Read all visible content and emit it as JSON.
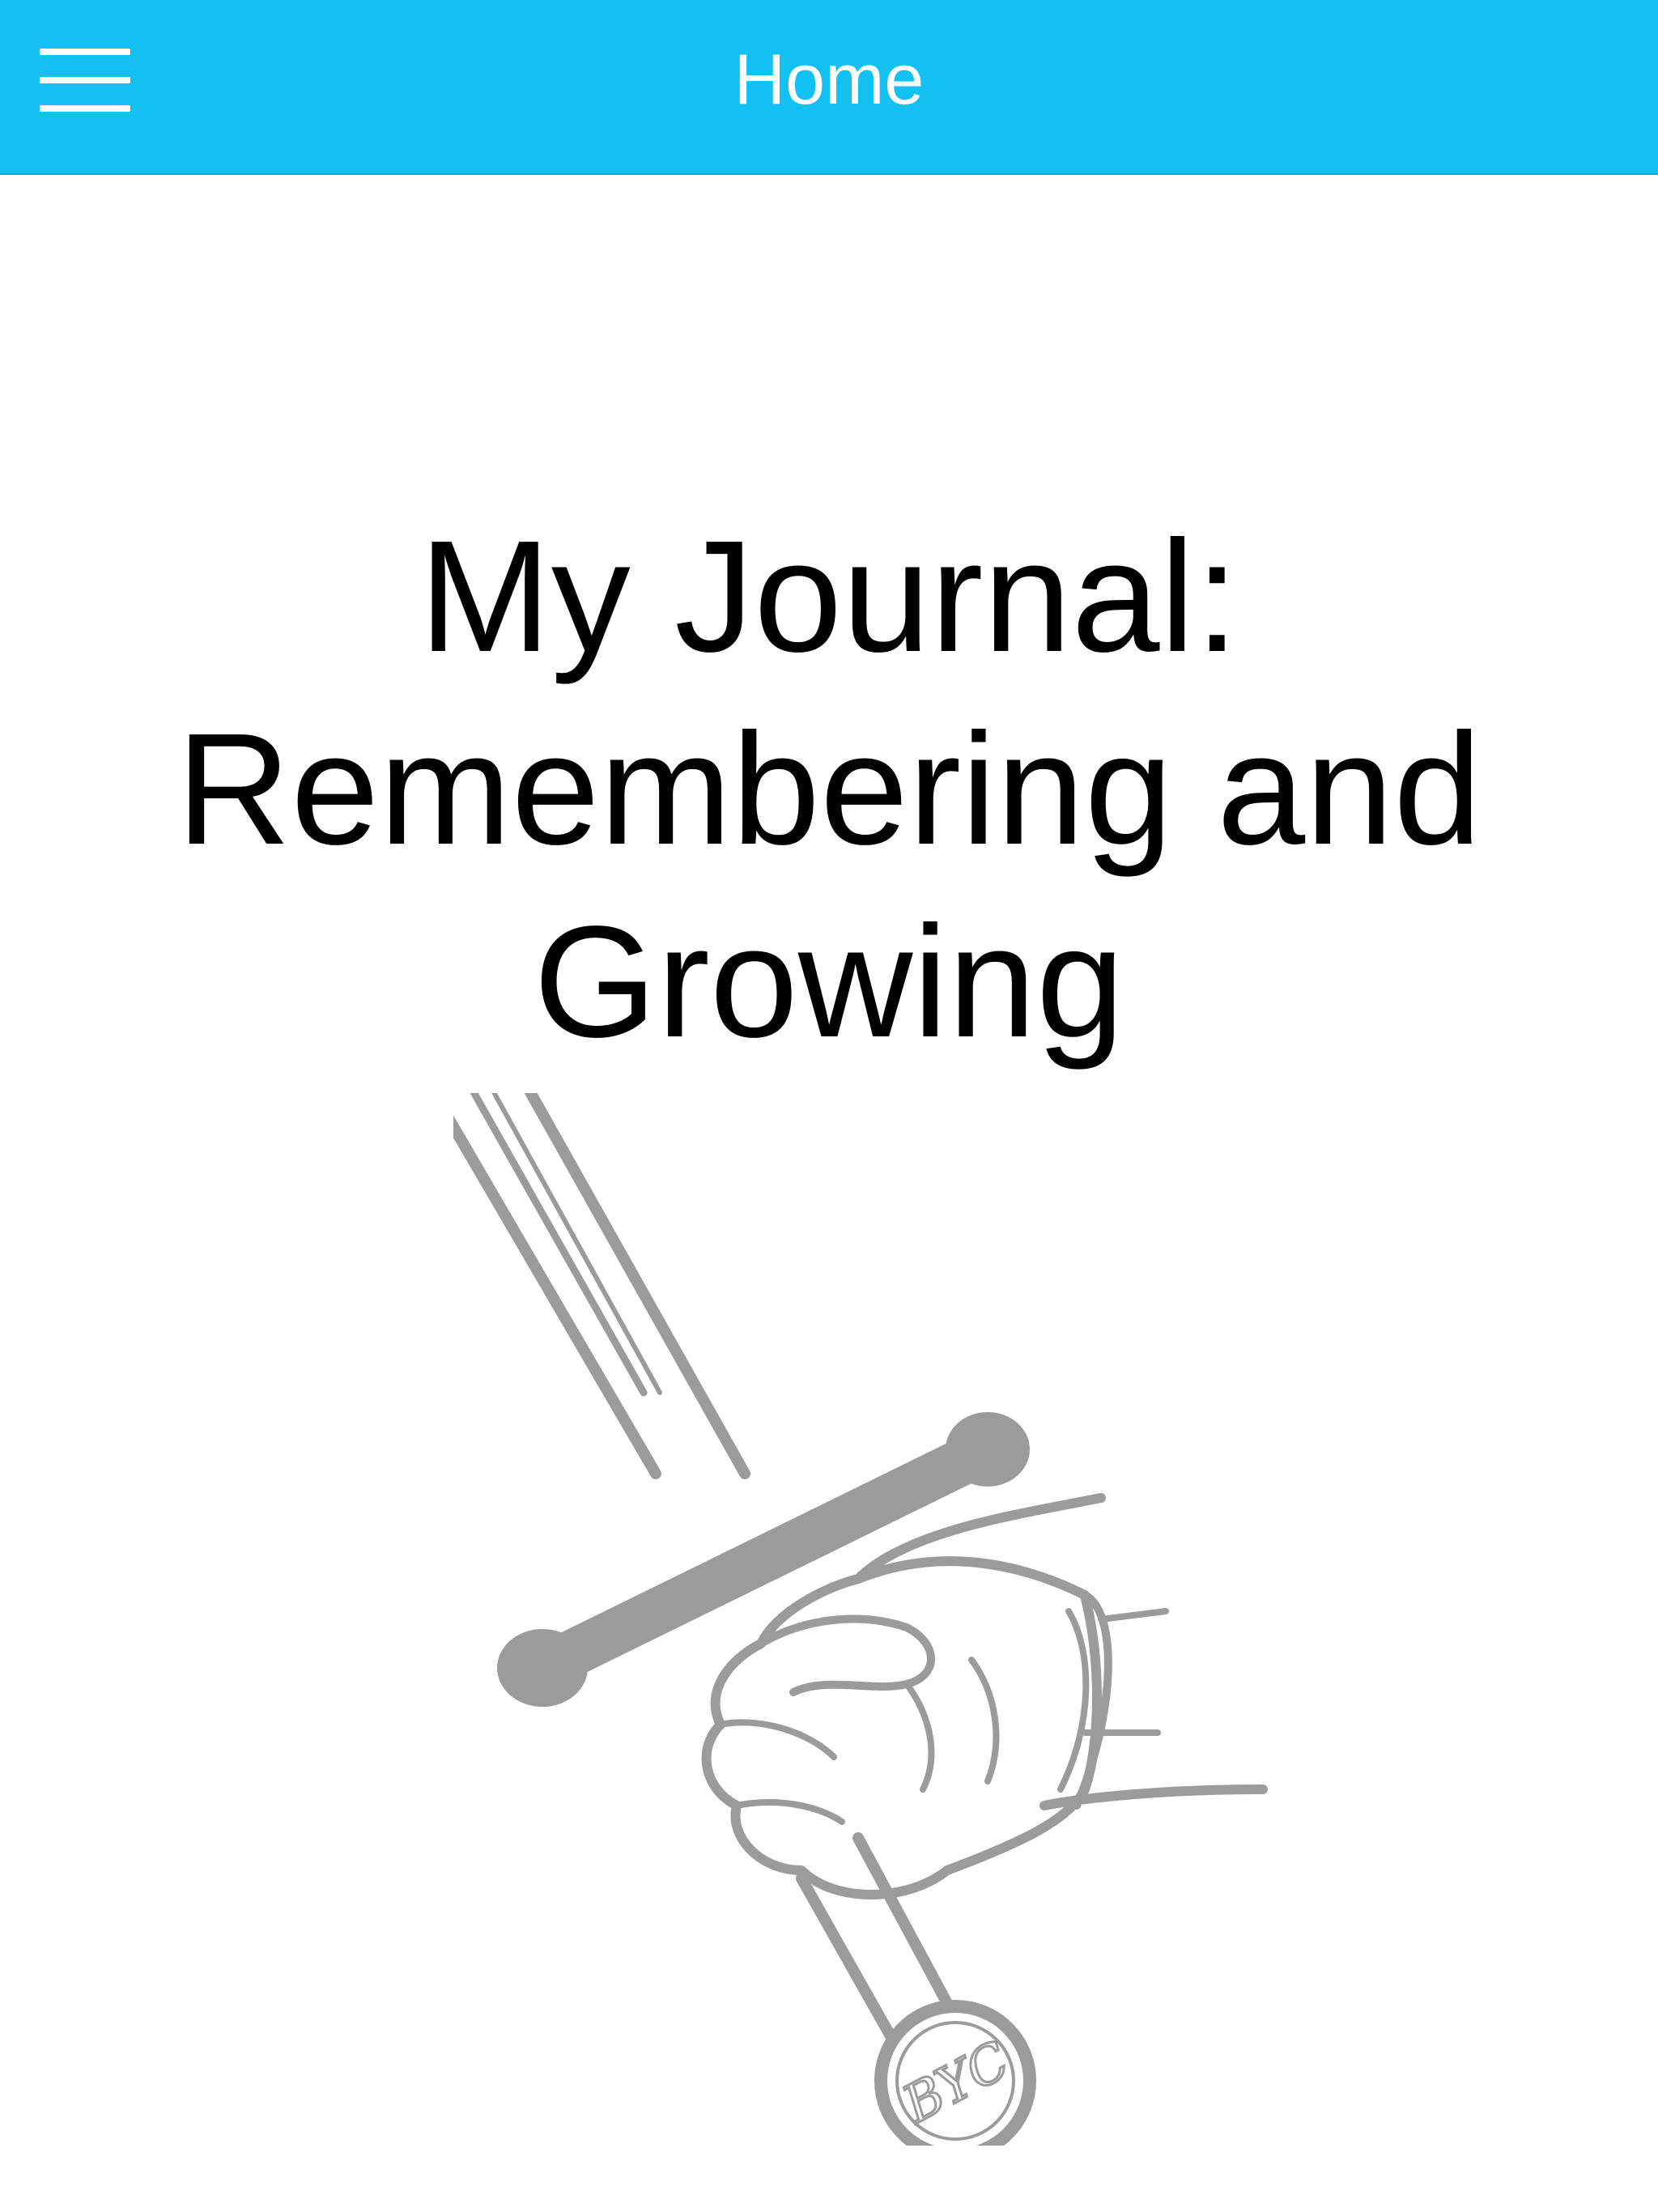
{
  "navbar": {
    "title": "Home",
    "menu_icon": "hamburger-menu-icon",
    "background_color": "#12c1f1",
    "title_color": "#ffffff"
  },
  "main": {
    "title": "My Journal: Remembering and Growing",
    "logo": {
      "icon": "hand-holding-sword-icon",
      "monogram": "BYC",
      "color": "#9b9b9b"
    }
  }
}
